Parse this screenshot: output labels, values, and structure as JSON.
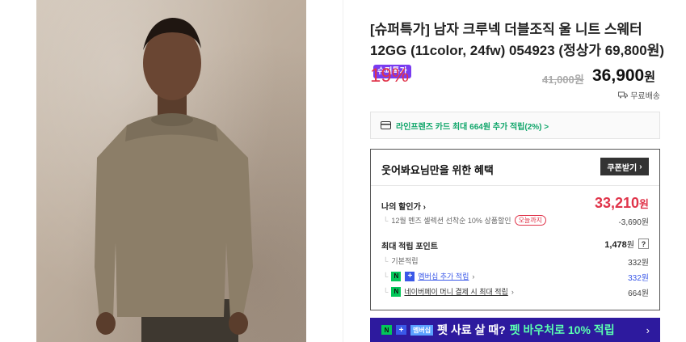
{
  "product": {
    "title": "[슈퍼특가] 남자 크루넥 더블조직 울 니트 스웨터 12GG (11color, 24fw) 054923 (정상가 69,800원)",
    "badge": "슈퍼특가",
    "discount_rate": "19%",
    "original_price": "41,000원",
    "price": "36,900",
    "price_unit": "원",
    "shipping": "무료배송"
  },
  "card_benefit": {
    "text": "라인프렌즈 카드 최대 664원 추가 적립(2%) >"
  },
  "benefit": {
    "title": "웃어봐요님만을 위한 혜택",
    "coupon_button": "쿠폰받기",
    "my_price_label": "나의 할인가",
    "my_price": "33,210",
    "my_price_unit": "원",
    "discount_line": "12월 멘즈 셀렉션 선착순 10% 상품할인",
    "today_tag": "오늘까지",
    "discount_amount": "-3,690원",
    "points_label": "최대 적립 포인트",
    "points_value": "1,478",
    "points_unit": "원",
    "points_help": "?",
    "basic_label": "기본적립",
    "basic_value": "332원",
    "membership_label": "멤버십 추가 적립",
    "membership_value": "332원",
    "npay_label": "네이버페이 머니 결제 시 최대 적립",
    "npay_value": "664원"
  },
  "banner": {
    "n_logo": "N",
    "plus_logo": "+",
    "membership_tag": "멤버십",
    "text1": "펫 사료 살 때?",
    "text2": "펫 바우처로 10% 적립",
    "chevron": "›"
  },
  "colors": {
    "accent_red": "#e0344a",
    "badge_purple": "#7a3cf0",
    "naver_green": "#03c75a",
    "banner_navy": "#2d1a9e"
  }
}
